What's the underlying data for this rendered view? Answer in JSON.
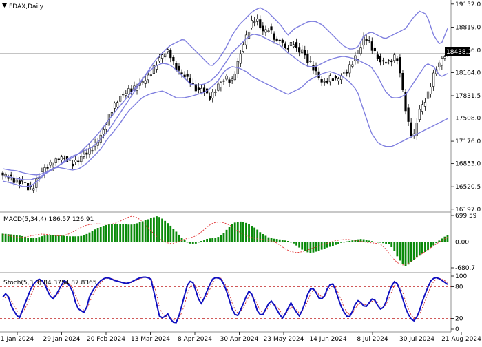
{
  "chart_data": [
    {
      "type": "candlestick",
      "title": "FDAX,Daily",
      "y_ticks": [
        16197,
        16520.5,
        16853,
        17176,
        17508,
        17831.5,
        18164,
        18486,
        18819,
        19152
      ],
      "y_tick_labels": [
        "16197.0",
        "16520.5",
        "16853.0",
        "17176.0",
        "17508.0",
        "17831.5",
        "18164.0",
        "18486.0",
        "18819.0",
        "19152.0"
      ],
      "ylim": [
        16175,
        19180
      ],
      "current_price": 18438.1,
      "current_price_label": "18438.1",
      "x_labels": [
        "1 Jan 2024",
        "29 Jan 2024",
        "20 Feb 2024",
        "13 Mar 2024",
        "8 Apr 2024",
        "30 Apr 2024",
        "23 May 2024",
        "14 Jun 2024",
        "8 Jul 2024",
        "30 Jul 2024",
        "21 Aug 2024"
      ],
      "close_path": [
        16690,
        16680,
        16640,
        16600,
        16580,
        16620,
        16500,
        16480,
        16600,
        16700,
        16780,
        16820,
        16860,
        16900,
        16950,
        16920,
        16880,
        16850,
        16900,
        16960,
        17000,
        17050,
        17100,
        17200,
        17300,
        17450,
        17600,
        17700,
        17800,
        17850,
        17900,
        17920,
        17950,
        18000,
        18050,
        18100,
        18200,
        18300,
        18400,
        18450,
        18480,
        18300,
        18200,
        18150,
        18100,
        18050,
        17950,
        17900,
        17950,
        17850,
        17800,
        17900,
        18000,
        18050,
        18100,
        18000,
        18200,
        18400,
        18600,
        18750,
        18900,
        18950,
        18800,
        18750,
        18800,
        18700,
        18600,
        18650,
        18500,
        18550,
        18600,
        18450,
        18500,
        18350,
        18300,
        18200,
        18100,
        18000,
        18050,
        18100,
        18050,
        18100,
        18150,
        18200,
        18300,
        18400,
        18500,
        18700,
        18600,
        18500,
        18400,
        18300,
        18350,
        18300,
        18400,
        18350,
        18000,
        17600,
        17300,
        17250,
        17600,
        17700,
        17800,
        18000,
        18200,
        18300,
        18400,
        18438
      ],
      "upper_band_path": [
        16780,
        16760,
        16750,
        16720,
        16700,
        16690,
        16720,
        16760,
        16820,
        16900,
        16960,
        17000,
        17050,
        17100,
        17200,
        17300,
        17450,
        17600,
        17750,
        17900,
        18050,
        18200,
        18350,
        18450,
        18550,
        18600,
        18650,
        18550,
        18450,
        18350,
        18250,
        18350,
        18500,
        18700,
        18850,
        18950,
        19050,
        19100,
        19050,
        18950,
        18850,
        18700,
        18800,
        18850,
        18900,
        18900,
        18850,
        18750,
        18650,
        18550,
        18500,
        18520,
        18700,
        18750,
        18700,
        18650,
        18700,
        18750,
        18800,
        18950,
        19050,
        19000,
        18700,
        18550,
        18800
      ],
      "middle_band_path": [
        16680,
        16660,
        16640,
        16620,
        16620,
        16650,
        16700,
        16760,
        16820,
        16880,
        16940,
        17000,
        17100,
        17200,
        17320,
        17450,
        17580,
        17700,
        17820,
        17940,
        18060,
        18180,
        18260,
        18300,
        18280,
        18200,
        18100,
        18000,
        17980,
        18000,
        18050,
        18150,
        18300,
        18450,
        18550,
        18650,
        18720,
        18700,
        18650,
        18600,
        18550,
        18450,
        18380,
        18300,
        18250,
        18250,
        18300,
        18350,
        18380,
        18400,
        18380,
        18350,
        18300,
        18250,
        18100,
        17900,
        17800,
        17800,
        17850,
        18000,
        18150,
        18300,
        18250,
        18100,
        18150
      ],
      "lower_band_path": [
        16600,
        16580,
        16550,
        16520,
        16530,
        16600,
        16700,
        16780,
        16800,
        16780,
        16760,
        16780,
        16850,
        16950,
        17050,
        17200,
        17320,
        17450,
        17600,
        17700,
        17800,
        17850,
        17880,
        17900,
        17850,
        17800,
        17800,
        17820,
        17850,
        17880,
        17950,
        18050,
        18200,
        18250,
        18230,
        18180,
        18100,
        18050,
        18000,
        17950,
        17900,
        17850,
        17900,
        17950,
        18050,
        18100,
        18150,
        18180,
        18150,
        18100,
        18020,
        17900,
        17600,
        17300,
        17150,
        17100,
        17100,
        17150,
        17200,
        17250,
        17300,
        17350,
        17400,
        17450,
        17500
      ]
    },
    {
      "type": "bar",
      "title": "MACD(5,34,4) 186.57 126.91",
      "y_tick_labels": [
        "699.59",
        "0.00",
        "-680.7"
      ],
      "ylim": [
        -680.7,
        699.59
      ],
      "values": [
        220,
        210,
        200,
        190,
        170,
        150,
        120,
        100,
        110,
        140,
        170,
        180,
        185,
        180,
        170,
        160,
        150,
        150,
        150,
        160,
        200,
        260,
        320,
        380,
        420,
        450,
        470,
        480,
        480,
        470,
        460,
        460,
        480,
        520,
        560,
        600,
        640,
        680,
        650,
        560,
        470,
        360,
        240,
        120,
        20,
        -40,
        -60,
        -20,
        40,
        80,
        100,
        110,
        140,
        220,
        340,
        460,
        520,
        540,
        530,
        480,
        420,
        350,
        250,
        180,
        120,
        90,
        80,
        60,
        40,
        20,
        -40,
        -120,
        -200,
        -260,
        -290,
        -270,
        -230,
        -190,
        -150,
        -120,
        -80,
        -40,
        0,
        20,
        40,
        60,
        80,
        70,
        40,
        20,
        0,
        -20,
        -40,
        -60,
        -200,
        -400,
        -560,
        -640,
        -560,
        -460,
        -380,
        -300,
        -240,
        -140,
        -60,
        40,
        120,
        186.57
      ],
      "signal_path": [
        200,
        170,
        140,
        120,
        130,
        160,
        190,
        210,
        200,
        180,
        160,
        170,
        220,
        300,
        380,
        440,
        470,
        480,
        470,
        465,
        480,
        540,
        620,
        680,
        660,
        560,
        400,
        240,
        100,
        10,
        -40,
        -30,
        30,
        90,
        120,
        180,
        300,
        430,
        510,
        530,
        500,
        430,
        320,
        220,
        150,
        110,
        80,
        60,
        40,
        0,
        -100,
        -200,
        -260,
        -280,
        -250,
        -200,
        -150,
        -100,
        -50,
        0,
        40,
        60,
        70,
        50,
        30,
        0,
        -20,
        -30,
        -60,
        -200,
        -400,
        -550,
        -610,
        -560,
        -450,
        -350,
        -250,
        -150,
        -50,
        40,
        126.91
      ]
    },
    {
      "type": "line",
      "title": "Stoch(5,3,3) 84.3754 87.8365",
      "y_tick_labels": [
        "100",
        "80",
        "20",
        "0"
      ],
      "ylim": [
        0,
        100
      ],
      "levels": [
        80,
        20
      ],
      "series": [
        {
          "values": [
            60,
            70,
            45,
            30,
            20,
            40,
            60,
            80,
            90,
            95,
            88,
            70,
            55,
            65,
            80,
            92,
            85,
            70,
            40,
            35,
            30,
            60,
            75,
            85,
            93,
            97,
            96,
            92,
            90,
            88,
            86,
            88,
            92,
            96,
            98,
            98,
            94,
            60,
            25,
            20,
            30,
            15,
            10,
            30,
            60,
            88,
            92,
            70,
            45,
            60,
            80,
            95,
            98,
            94,
            80,
            55,
            30,
            25,
            40,
            60,
            75,
            55,
            30,
            25,
            40,
            55,
            45,
            30,
            20,
            35,
            50,
            35,
            25,
            40,
            65,
            80,
            70,
            55,
            60,
            80,
            88,
            70,
            45,
            30,
            20,
            35,
            55,
            50,
            40,
            50,
            60,
            45,
            35,
            50,
            75,
            90,
            85,
            60,
            35,
            20,
            15,
            30,
            55,
            75,
            92,
            98,
            95,
            90,
            84.38
          ]
        },
        {
          "values": [
            55,
            62,
            55,
            40,
            28,
            32,
            48,
            68,
            84,
            92,
            90,
            78,
            62,
            62,
            74,
            86,
            88,
            78,
            55,
            40,
            34,
            48,
            68,
            80,
            90,
            95,
            96,
            94,
            91,
            89,
            87,
            87,
            90,
            94,
            97,
            98,
            96,
            78,
            42,
            25,
            24,
            20,
            15,
            22,
            42,
            72,
            88,
            80,
            58,
            55,
            70,
            88,
            96,
            96,
            86,
            66,
            42,
            30,
            34,
            50,
            66,
            62,
            42,
            30,
            34,
            48,
            48,
            38,
            27,
            30,
            42,
            40,
            30,
            35,
            52,
            72,
            74,
            62,
            60,
            72,
            84,
            78,
            58,
            38,
            27,
            30,
            45,
            50,
            45,
            48,
            55,
            50,
            40,
            45,
            62,
            82,
            86,
            72,
            48,
            28,
            20,
            25,
            42,
            62,
            82,
            94,
            96,
            93,
            87.84
          ]
        }
      ]
    }
  ],
  "colors": {
    "candle_outline": "#000000",
    "band": "#7f7fdf",
    "macd_bar": "#0a8a0a",
    "macd_signal": "#e03030",
    "stoch_main": "#1010c0",
    "stoch_signal": "#d03030",
    "level_line": "#c02020",
    "grid_sep": "#909090",
    "price_line": "#a0a0a0"
  }
}
